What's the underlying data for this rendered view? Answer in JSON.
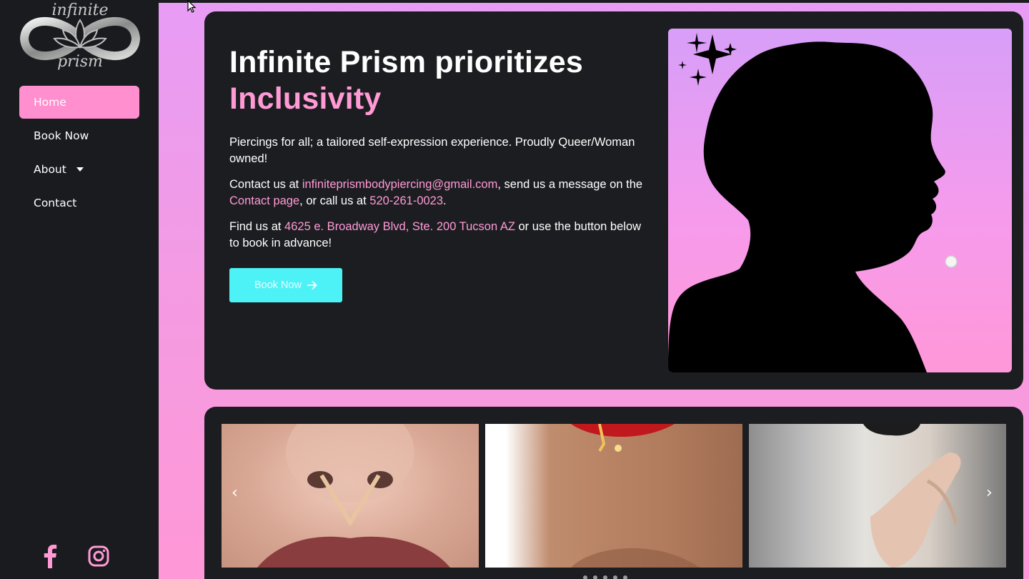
{
  "sidebar": {
    "logo": {
      "line1": "infinite",
      "line2": "prism"
    },
    "nav": [
      {
        "label": "Home",
        "active": true
      },
      {
        "label": "Book Now"
      },
      {
        "label": "About",
        "has_dropdown": true
      },
      {
        "label": "Contact"
      }
    ],
    "social": [
      "facebook-icon",
      "instagram-icon"
    ]
  },
  "hero": {
    "title_line1": "Infinite Prism prioritizes",
    "title_line2": "Inclusivity",
    "p1": "Piercings for all; a tailored self-expression experience. Proudly Queer/Woman owned!",
    "p2_prefix": "Contact us at ",
    "p2_email": "infiniteprismbodypiercing@gmail.com",
    "p2_mid": ", send us a message on the ",
    "p2_link": "Contact page",
    "p2_mid2": ", or call us at ",
    "p2_phone": "520-261-0023",
    "p2_end": ".",
    "p3_prefix": "Find us at ",
    "p3_address": "4625 e. Broadway Blvd, Ste. 200 Tucson AZ",
    "p3_end": " or use the button below to book in advance!",
    "book_label": "Book Now"
  },
  "gallery": {
    "prev_arrow": "‹",
    "next_arrow": "›",
    "dot_count": 5
  },
  "colors": {
    "accent_pink": "#ff9ad5",
    "button_cyan": "#4df2f6",
    "card_bg": "#1c1d21"
  }
}
